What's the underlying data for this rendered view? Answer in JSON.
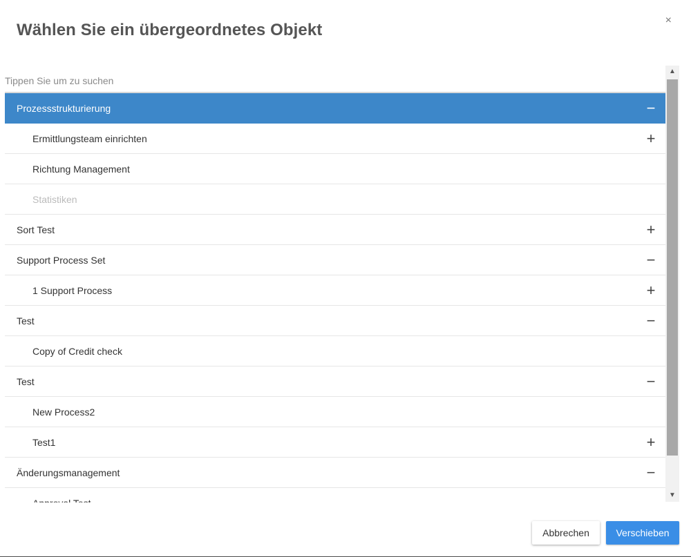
{
  "dialog": {
    "title": "Wählen Sie ein übergeordnetes Objekt",
    "close_glyph": "×"
  },
  "search": {
    "placeholder": "Tippen Sie um zu suchen",
    "value": ""
  },
  "tree": {
    "rows": [
      {
        "label": "Prozessstrukturierung",
        "level": 0,
        "toggle": "−",
        "selected": true,
        "disabled": false
      },
      {
        "label": "Ermittlungsteam einrichten",
        "level": 1,
        "toggle": "+",
        "selected": false,
        "disabled": false
      },
      {
        "label": "Richtung Management",
        "level": 1,
        "toggle": "",
        "selected": false,
        "disabled": false
      },
      {
        "label": "Statistiken",
        "level": 1,
        "toggle": "",
        "selected": false,
        "disabled": true
      },
      {
        "label": "Sort Test",
        "level": 0,
        "toggle": "+",
        "selected": false,
        "disabled": false
      },
      {
        "label": "Support Process Set",
        "level": 0,
        "toggle": "−",
        "selected": false,
        "disabled": false
      },
      {
        "label": "1 Support Process",
        "level": 1,
        "toggle": "+",
        "selected": false,
        "disabled": false
      },
      {
        "label": "Test",
        "level": 0,
        "toggle": "−",
        "selected": false,
        "disabled": false
      },
      {
        "label": "Copy of Credit check",
        "level": 1,
        "toggle": "",
        "selected": false,
        "disabled": false
      },
      {
        "label": "Test",
        "level": 0,
        "toggle": "−",
        "selected": false,
        "disabled": false
      },
      {
        "label": "New Process2",
        "level": 1,
        "toggle": "",
        "selected": false,
        "disabled": false
      },
      {
        "label": "Test1",
        "level": 1,
        "toggle": "+",
        "selected": false,
        "disabled": false
      },
      {
        "label": "Änderungsmanagement",
        "level": 0,
        "toggle": "−",
        "selected": false,
        "disabled": false
      },
      {
        "label": "Approval Test",
        "level": 1,
        "toggle": "",
        "selected": false,
        "disabled": false
      }
    ]
  },
  "scrollbar": {
    "up_glyph": "^",
    "down_glyph": "v"
  },
  "footer": {
    "cancel_label": "Abbrechen",
    "move_label": "Verschieben"
  },
  "colors": {
    "selected_row": "#3d87c9",
    "primary_button": "#3a8ee6",
    "title": "#555555"
  }
}
